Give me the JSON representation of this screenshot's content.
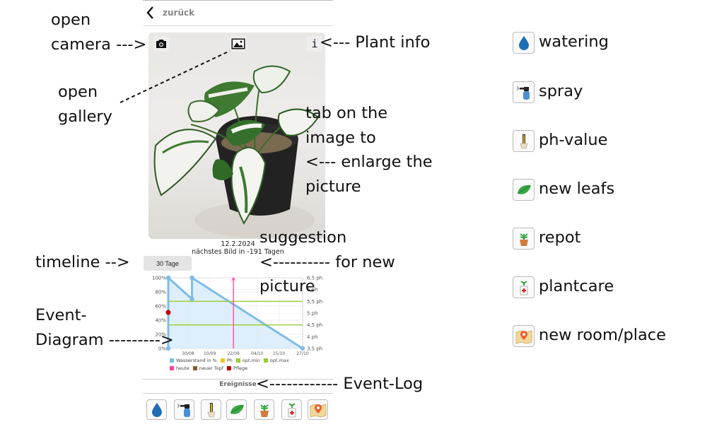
{
  "header": {
    "back_label": "zurück"
  },
  "photo": {
    "date": "12.2.2024",
    "next_picture": "nächstes Bild in -191 Tagen"
  },
  "timeline": {
    "button_label": "30 Tage"
  },
  "chart_data": {
    "type": "line",
    "x_ticks": [
      "30/08",
      "10/09",
      "22/09",
      "04/10",
      "15/10",
      "27/10"
    ],
    "y_left_ticks": [
      "100%",
      "80%",
      "60%",
      "40%",
      "20%",
      "0%"
    ],
    "y_right_ticks": [
      "6,5 ph",
      "6 ph",
      "5,5 ph",
      "5 ph",
      "4,5 ph",
      "4 ph",
      "3,5 ph"
    ],
    "ylim_left": [
      0,
      100
    ],
    "ylim_right": [
      3.5,
      6.5
    ],
    "series": [
      {
        "name": "Wasserstand in %",
        "color": "#7cbde6",
        "points": [
          [
            "20/08",
            0
          ],
          [
            "20/08",
            100
          ],
          [
            "01/09",
            70
          ],
          [
            "01/09",
            100
          ],
          [
            "27/10",
            0
          ]
        ]
      },
      {
        "name": "opt.min",
        "color": "#9acd32",
        "value_ph": 4.5
      },
      {
        "name": "opt.max",
        "color": "#9acd32",
        "value_ph": 5.5
      },
      {
        "name": "heute",
        "color": "#ff3fa4",
        "x": "22/09"
      },
      {
        "name": "Pflege",
        "color": "#c00000",
        "points": [
          [
            "20/08",
            51
          ]
        ]
      }
    ],
    "legend": [
      {
        "label": "Wasserstand in %",
        "color": "#7cbde6"
      },
      {
        "label": "Ph",
        "color": "#f0c419"
      },
      {
        "label": "opt.min",
        "color": "#9acd32"
      },
      {
        "label": "opt.max",
        "color": "#9acd32"
      },
      {
        "label": "heute",
        "color": "#ff3fa4"
      },
      {
        "label": "neuer Topf",
        "color": "#8b5a2b"
      },
      {
        "label": "Pflege",
        "color": "#c00000"
      }
    ]
  },
  "events": {
    "label": "Ereignisse"
  },
  "annotations": {
    "open_camera": "open\ncamera --->",
    "plant_info": "<--- Plant info",
    "open_gallery": "open\ngallery",
    "enlarge": "tab on the\nimage to\n<--- enlarge the\npicture",
    "suggestion": "suggestion\n<---------- for new\npicture",
    "timeline": "timeline -->",
    "event_diagram": "Event-\nDiagram --------->",
    "event_log": "<------------ Event-Log"
  },
  "icon_legend": [
    {
      "label": "watering",
      "icon": "water-drop-icon"
    },
    {
      "label": "spray",
      "icon": "spray-bottle-icon"
    },
    {
      "label": "ph-value",
      "icon": "ph-meter-icon"
    },
    {
      "label": "new leafs",
      "icon": "leaf-icon"
    },
    {
      "label": "repot",
      "icon": "potted-plant-icon"
    },
    {
      "label": "plantcare",
      "icon": "plant-care-icon"
    },
    {
      "label": "new room/place",
      "icon": "map-pin-icon"
    }
  ]
}
